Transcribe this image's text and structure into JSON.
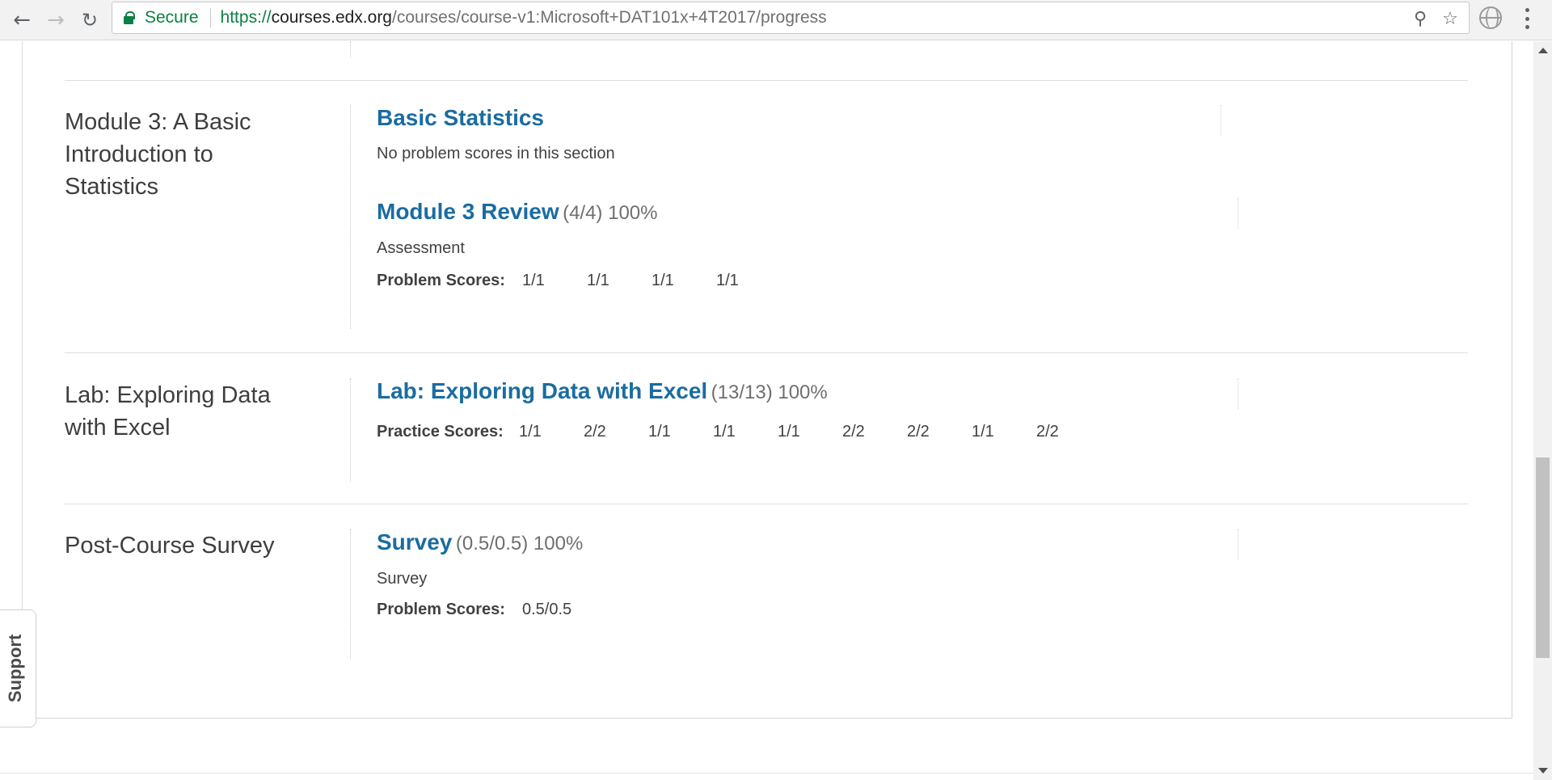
{
  "browser": {
    "secure_label": "Secure",
    "url_scheme": "https://",
    "url_host": "courses.edx.org",
    "url_path": "/courses/course-v1:Microsoft+DAT101x+4T2017/progress",
    "icons": [
      "back-icon",
      "forward-icon",
      "reload-icon",
      "lock-icon",
      "zoom-icon",
      "bookmark-star-icon",
      "globe-icon",
      "menu-icon"
    ]
  },
  "chapters": [
    {
      "title": "Module 3: A Basic Introduction to Statistics",
      "sections": [
        {
          "title": "Basic Statistics",
          "stats": "",
          "note": "No problem scores in this section"
        },
        {
          "title": "Module 3 Review",
          "stats": "(4/4) 100%",
          "format": "Assessment",
          "scores_label": "Problem Scores:",
          "scores": [
            "1/1",
            "1/1",
            "1/1",
            "1/1"
          ]
        }
      ]
    },
    {
      "title": "Lab: Exploring Data with Excel",
      "sections": [
        {
          "title": "Lab: Exploring Data with Excel",
          "stats": "(13/13) 100%",
          "scores_label": "Practice Scores:",
          "scores": [
            "1/1",
            "2/2",
            "1/1",
            "1/1",
            "1/1",
            "2/2",
            "2/2",
            "1/1",
            "2/2"
          ]
        }
      ]
    },
    {
      "title": "Post-Course Survey",
      "sections": [
        {
          "title": "Survey",
          "stats": "(0.5/0.5) 100%",
          "format": "Survey",
          "scores_label": "Problem Scores:",
          "scores": [
            "0.5/0.5"
          ]
        }
      ]
    }
  ],
  "support_tab": {
    "label": "Support"
  },
  "colors": {
    "link": "#1a6ca1",
    "secure": "#0b8043",
    "text": "#313131"
  }
}
